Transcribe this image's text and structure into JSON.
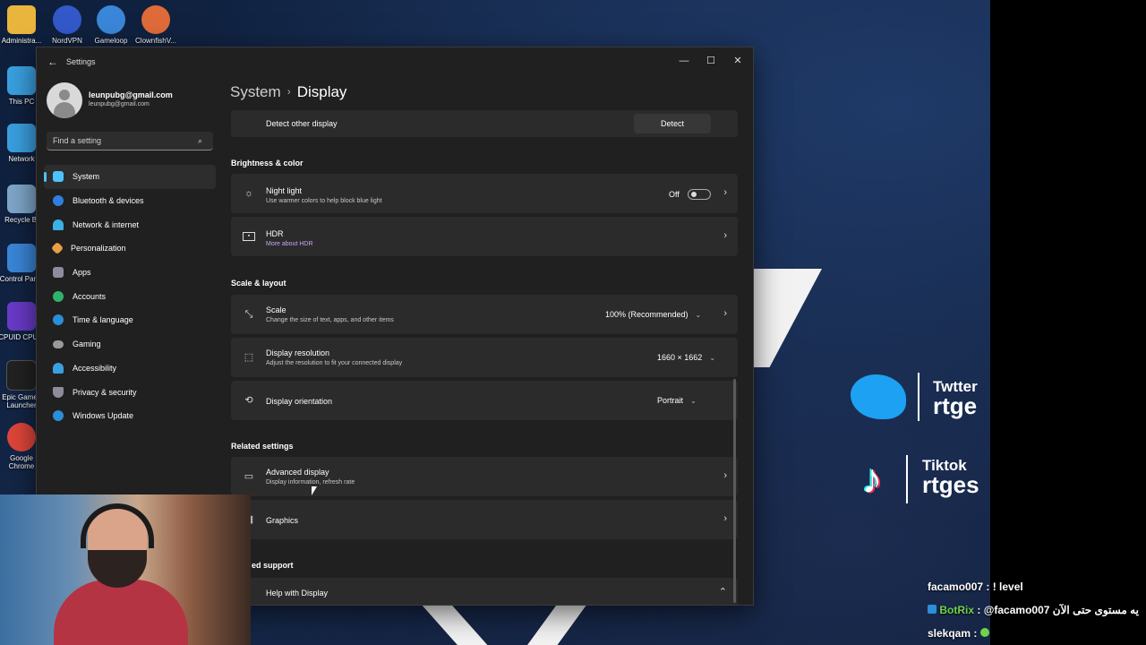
{
  "desktop": {
    "icons": [
      {
        "label": "Administra...",
        "color": "#e9b53c"
      },
      {
        "label": "NordVPN",
        "color": "#3358c9"
      },
      {
        "label": "Gameloop",
        "color": "#3a86d8"
      },
      {
        "label": "ClownfishV...",
        "color": "#e06b3a"
      },
      {
        "label": "This PC",
        "color": "#3aa0e0"
      },
      {
        "label": "Network",
        "color": "#3aa0e0"
      },
      {
        "label": "Recycle Bi",
        "color": "#7fa7c9"
      },
      {
        "label": "Control Panel",
        "color": "#3a86d8"
      },
      {
        "label": "CPUID CPU-Z",
        "color": "#6a3ac9"
      },
      {
        "label": "Epic Games Launcher",
        "color": "#222222"
      },
      {
        "label": "Google Chrome",
        "color": "#e0453a"
      }
    ]
  },
  "promo": {
    "twitter_label": "Twtter",
    "twitter_handle": "rtge",
    "tiktok_label": "Tiktok",
    "tiktok_handle": "rtges"
  },
  "chat": [
    {
      "user": "facamo007",
      "text": ": ! level"
    },
    {
      "user": "BotRix",
      "text": ": @facamo007 يه مستوى حتى الآن"
    },
    {
      "user": "slekqam",
      "text": ":"
    }
  ],
  "window": {
    "title": "Settings",
    "controls": {
      "minimize": "—",
      "maximize": "☐",
      "close": "✕"
    }
  },
  "profile": {
    "name": "leunpubg@gmail.com",
    "email": "leunpubg@gmail.com"
  },
  "search": {
    "placeholder": "Find a setting"
  },
  "nav": [
    {
      "label": "System",
      "icon": "monitor-icon",
      "color": "#4cc2ff",
      "active": true
    },
    {
      "label": "Bluetooth & devices",
      "icon": "bluetooth-icon",
      "color": "#2f7fe0"
    },
    {
      "label": "Network & internet",
      "icon": "wifi-icon",
      "color": "#3ab0e6"
    },
    {
      "label": "Personalization",
      "icon": "brush-icon",
      "color": "#e8a045"
    },
    {
      "label": "Apps",
      "icon": "apps-icon",
      "color": "#8c8c9c"
    },
    {
      "label": "Accounts",
      "icon": "person-icon",
      "color": "#2fb36b"
    },
    {
      "label": "Time & language",
      "icon": "globe-icon",
      "color": "#2a8fd6"
    },
    {
      "label": "Gaming",
      "icon": "gamepad-icon",
      "color": "#9a9a9a"
    },
    {
      "label": "Accessibility",
      "icon": "accessibility-icon",
      "color": "#3aa0e0"
    },
    {
      "label": "Privacy & security",
      "icon": "shield-icon",
      "color": "#8c8c9c"
    },
    {
      "label": "Windows Update",
      "icon": "update-icon",
      "color": "#2a8fd6"
    }
  ],
  "header": {
    "parent": "System",
    "current": "Display"
  },
  "detect": {
    "label": "Detect other display",
    "button": "Detect"
  },
  "brightness": {
    "title": "Brightness & color",
    "night_light": {
      "label": "Night light",
      "sub": "Use warmer colors to help block blue light",
      "state": "Off"
    },
    "hdr": {
      "label": "HDR",
      "sub": "More about HDR"
    }
  },
  "scale_layout": {
    "title": "Scale & layout",
    "scale": {
      "label": "Scale",
      "sub": "Change the size of text, apps, and other items",
      "value": "100% (Recommended)"
    },
    "resolution": {
      "label": "Display resolution",
      "sub": "Adjust the resolution to fit your connected display",
      "value": "1660 × 1662"
    },
    "orientation": {
      "label": "Display orientation",
      "value": "Portrait"
    }
  },
  "related": {
    "title": "Related settings",
    "advanced": {
      "label": "Advanced display",
      "sub": "Display information, refresh rate"
    },
    "graphics": {
      "label": "Graphics"
    }
  },
  "support": {
    "title": "ed support",
    "help": {
      "label": "Help with Display"
    }
  }
}
